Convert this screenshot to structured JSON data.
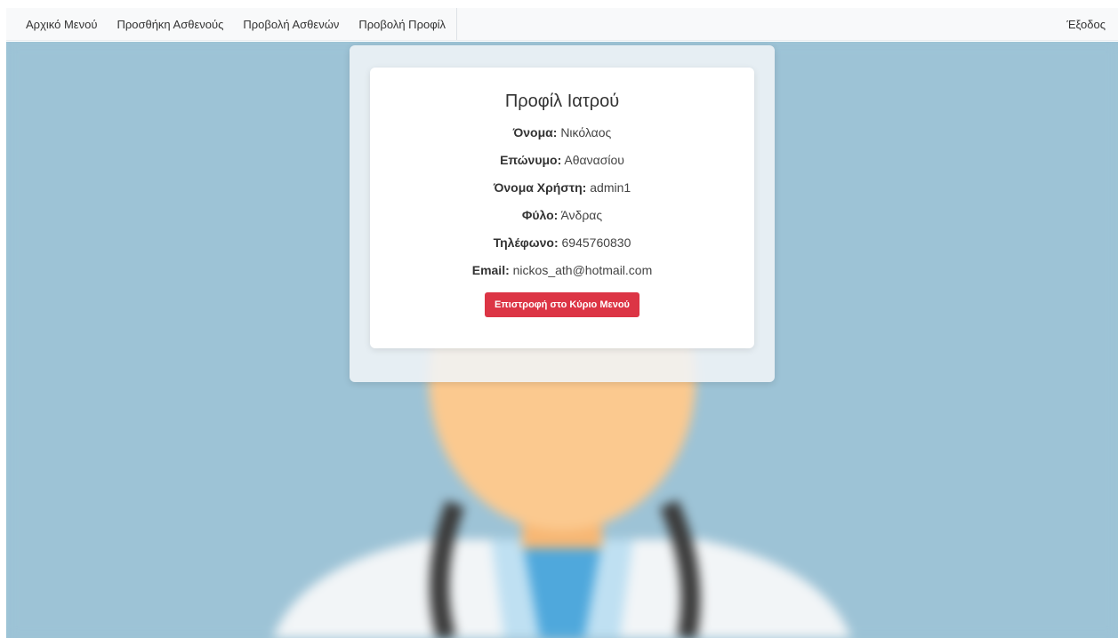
{
  "nav": {
    "items": [
      {
        "label": "Αρχικό Μενού"
      },
      {
        "label": "Προσθήκη Ασθενούς"
      },
      {
        "label": "Προβολή Ασθενών"
      },
      {
        "label": "Προβολή Προφίλ"
      }
    ],
    "logout": "Έξοδος"
  },
  "profile": {
    "title": "Προφίλ Ιατρού",
    "fields": [
      {
        "label": "Όνομα:",
        "value": "Νικόλαος"
      },
      {
        "label": "Επώνυμο:",
        "value": "Αθανασίου"
      },
      {
        "label": "Όνομα Χρήστη:",
        "value": "admin1"
      },
      {
        "label": "Φύλο:",
        "value": "Άνδρας"
      },
      {
        "label": "Τηλέφωνο:",
        "value": "6945760830"
      },
      {
        "label": "Email:",
        "value": "nickos_ath@hotmail.com"
      }
    ],
    "back_button": "Επιστροφή στο Κύριο Μενού"
  },
  "colors": {
    "background": "#9dc3d6",
    "button": "#dc3545",
    "navbar": "#f8f9fa"
  }
}
